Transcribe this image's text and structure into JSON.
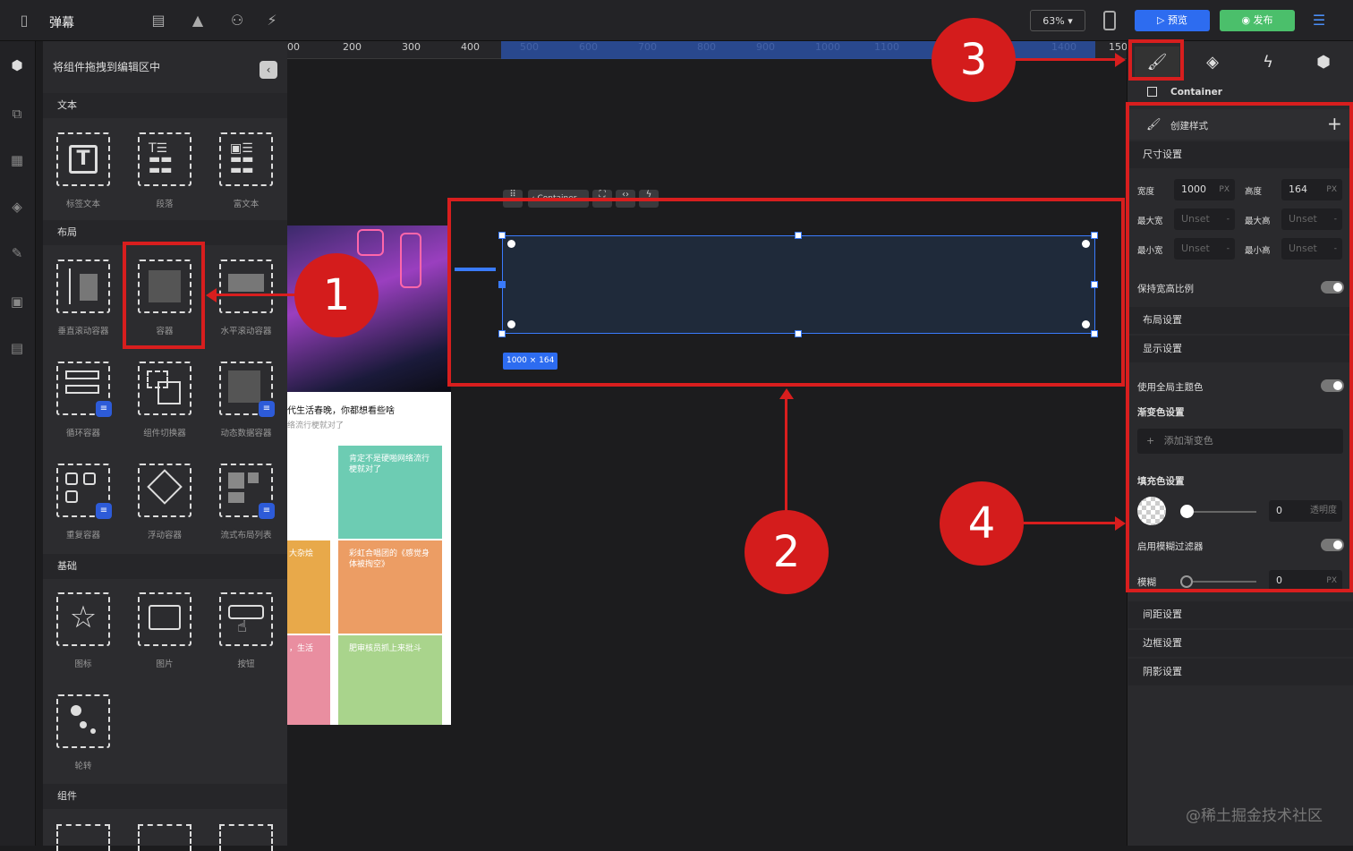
{
  "app": {
    "title": "弹幕",
    "zoom": "63%",
    "preview_label": "预览",
    "publish_label": "发布"
  },
  "library": {
    "header": "将组件拖拽到编辑区中",
    "sections": {
      "text": "文本",
      "layout": "布局",
      "basic": "基础",
      "components": "组件"
    },
    "text_items": [
      "标签文本",
      "段落",
      "富文本"
    ],
    "layout_items": [
      "垂直滚动容器",
      "容器",
      "水平滚动容器",
      "循环容器",
      "组件切换器",
      "动态数据容器",
      "重复容器",
      "浮动容器",
      "流式布局列表"
    ],
    "basic_items": [
      "图标",
      "图片",
      "按钮",
      "轮转"
    ]
  },
  "canvas": {
    "ruler_ticks": [
      "00",
      "200",
      "300",
      "400",
      "500",
      "600",
      "700",
      "800",
      "900",
      "1000",
      "1100",
      "1400",
      "150"
    ],
    "size_label": "1000 × 164",
    "toolbar_label": "Container",
    "preview": {
      "title": "代生活春晚，你都想看些啥",
      "subtitle": "络流行梗就对了",
      "tiles": [
        "肯定不是硬啪网络流行梗就对了",
        "大杂烩",
        "彩虹合唱团的《感觉身体被掏空》",
        "，生活",
        "肥审核员抓上来批斗"
      ]
    }
  },
  "panel": {
    "element_name": "Container",
    "create_style": "创建样式",
    "size_section": "尺寸设置",
    "width_label": "宽度",
    "width_value": "1000",
    "width_unit": "PX",
    "height_label": "高度",
    "height_value": "164",
    "height_unit": "PX",
    "max_w_label": "最大宽",
    "max_w_value": "Unset",
    "max_h_label": "最大高",
    "max_h_value": "Unset",
    "min_w_label": "最小宽",
    "min_w_value": "Unset",
    "min_h_label": "最小高",
    "min_h_value": "Unset",
    "dash": "-",
    "keep_ratio": "保持宽高比例",
    "layout_section": "布局设置",
    "display_section": "显示设置",
    "global_theme": "使用全局主题色",
    "gradient_section": "渐变色设置",
    "add_gradient": "添加渐变色",
    "fill_section": "填充色设置",
    "opacity_value": "0",
    "opacity_label": "透明度",
    "blur_filter": "启用模糊过滤器",
    "blur_label": "模糊",
    "blur_value": "0",
    "blur_unit": "PX",
    "spacing_section": "间距设置",
    "border_section": "边框设置",
    "shadow_section": "阴影设置"
  },
  "annotations": [
    "1",
    "2",
    "3",
    "4"
  ],
  "watermark": "@稀土掘金技术社区",
  "colors": {
    "accent": "#2d6cf0",
    "annotation": "#d81e1e",
    "publish": "#4bbf6b"
  }
}
